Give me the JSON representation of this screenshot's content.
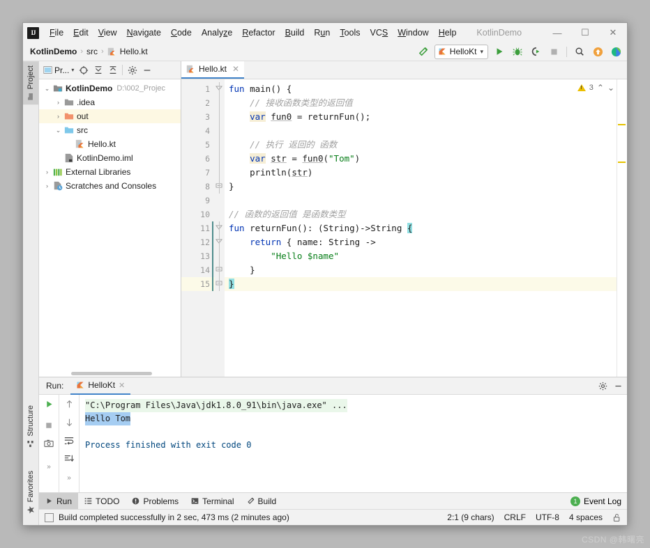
{
  "window": {
    "title": "KotlinDemo",
    "minimize": "—",
    "maximize": "☐",
    "close": "✕"
  },
  "menu": {
    "items": [
      {
        "label": "File",
        "mnemonic": "F"
      },
      {
        "label": "Edit",
        "mnemonic": "E"
      },
      {
        "label": "View",
        "mnemonic": "V"
      },
      {
        "label": "Navigate",
        "mnemonic": "N"
      },
      {
        "label": "Code",
        "mnemonic": "C"
      },
      {
        "label": "Analyze",
        "mnemonic": "z"
      },
      {
        "label": "Refactor",
        "mnemonic": "R"
      },
      {
        "label": "Build",
        "mnemonic": "B"
      },
      {
        "label": "Run",
        "mnemonic": "u"
      },
      {
        "label": "Tools",
        "mnemonic": "T"
      },
      {
        "label": "VCS",
        "mnemonic": "S"
      },
      {
        "label": "Window",
        "mnemonic": "W"
      },
      {
        "label": "Help",
        "mnemonic": "H"
      }
    ]
  },
  "breadcrumb": {
    "project": "KotlinDemo",
    "folder": "src",
    "file": "Hello.kt",
    "separator": "›"
  },
  "toolbar": {
    "run_config": "HelloKt",
    "dropdown_arrow": "▾",
    "icons": [
      "build-hammer-icon",
      "run-icon",
      "debug-icon",
      "run-coverage-icon",
      "stop-icon",
      "search-everywhere-icon",
      "update-project-icon",
      "ide-help-icon"
    ]
  },
  "tool_strip": {
    "left": [
      {
        "label": "Project",
        "active": true
      },
      {
        "label": "Structure",
        "active": false
      },
      {
        "label": "Favorites",
        "active": false
      }
    ]
  },
  "project_panel": {
    "title": "Pr...",
    "toolbar_icons": [
      "select-opened-file-icon",
      "expand-all-icon",
      "collapse-all-icon",
      "settings-gear-icon",
      "hide-icon"
    ],
    "tree": [
      {
        "label": "KotlinDemo",
        "path": "D:\\002_Projec",
        "icon": "module-icon",
        "twist": "⌄",
        "indent": 0,
        "bold": true,
        "highlight": false
      },
      {
        "label": ".idea",
        "path": "",
        "icon": "folder-grey-icon",
        "twist": "›",
        "indent": 1,
        "bold": false,
        "highlight": false
      },
      {
        "label": "out",
        "path": "",
        "icon": "folder-orange-icon",
        "twist": "›",
        "indent": 1,
        "bold": false,
        "highlight": true
      },
      {
        "label": "src",
        "path": "",
        "icon": "folder-blue-icon",
        "twist": "⌄",
        "indent": 1,
        "bold": false,
        "highlight": false
      },
      {
        "label": "Hello.kt",
        "path": "",
        "icon": "kotlin-file-icon",
        "twist": "",
        "indent": 2,
        "bold": false,
        "highlight": false
      },
      {
        "label": "KotlinDemo.iml",
        "path": "",
        "icon": "iml-file-icon",
        "twist": "",
        "indent": 1,
        "bold": false,
        "highlight": false
      },
      {
        "label": "External Libraries",
        "path": "",
        "icon": "libraries-icon",
        "twist": "›",
        "indent": 0,
        "bold": false,
        "highlight": false
      },
      {
        "label": "Scratches and Consoles",
        "path": "",
        "icon": "scratches-icon",
        "twist": "›",
        "indent": 0,
        "bold": false,
        "highlight": false
      }
    ]
  },
  "editor": {
    "tab": {
      "label": "Hello.kt",
      "icon": "kotlin-file-icon",
      "close": "✕"
    },
    "inspection": {
      "count": "3",
      "icon": "warning-triangle-icon",
      "prev": "⌃",
      "next": "⌄"
    },
    "line_count": 15,
    "current_line": 15,
    "lines": [
      {
        "n": "1",
        "html": "<span class=\"kw\">fun</span> <span class=\"fnname\">main</span>() {"
      },
      {
        "n": "2",
        "html": "    <span class=\"cmt\">// 接收函数类型的返回值</span>"
      },
      {
        "n": "3",
        "html": "    <span class=\"kw varhl\">var</span> <span class=\"und\">fun0</span> = <span class=\"fnname\">returnFun</span>();"
      },
      {
        "n": "4",
        "html": ""
      },
      {
        "n": "5",
        "html": "    <span class=\"cmt\">// 执行 返回的 函数</span>"
      },
      {
        "n": "6",
        "html": "    <span class=\"kw varhl\">var</span> <span class=\"und\">str</span> = <span class=\"und\">fun0</span>(<span class=\"str\">\"Tom\"</span>)"
      },
      {
        "n": "7",
        "html": "    <span class=\"fnname\">println</span>(<span class=\"und\">str</span>)"
      },
      {
        "n": "8",
        "html": "}"
      },
      {
        "n": "9",
        "html": ""
      },
      {
        "n": "10",
        "html": "<span class=\"cmt\">// 函数的返回值 是函数类型</span>"
      },
      {
        "n": "11",
        "html": "<span class=\"kw\">fun</span> <span class=\"fnname\">returnFun</span>(): (String)-&gt;String <span class=\"brhl\">{</span>"
      },
      {
        "n": "12",
        "html": "    <span class=\"kw\">return</span> { name: String -&gt;"
      },
      {
        "n": "13",
        "html": "        <span class=\"str\">\"Hello $name\"</span>"
      },
      {
        "n": "14",
        "html": "    }"
      },
      {
        "n": "15",
        "html": "<span class=\"brhl\">}</span>"
      }
    ],
    "plain_text": "fun main() {\n    // 接收函数类型的返回值\n    var fun0 = returnFun();\n\n    // 执行 返回的 函数\n    var str = fun0(\"Tom\")\n    println(str)\n}\n\n// 函数的返回值 是函数类型\nfun returnFun(): (String)->String {\n    return { name: String ->\n        \"Hello $name\"\n    }\n}"
  },
  "run_window": {
    "label": "Run:",
    "tab": "HelloKt",
    "tab_close": "✕",
    "header_icons": [
      "settings-gear-icon",
      "hide-icon"
    ],
    "tools_left": [
      "rerun-icon",
      "stop-icon",
      "screenshot-icon",
      "expand-icon"
    ],
    "tools_right": [
      "up-arrow-icon",
      "down-arrow-icon",
      "soft-wrap-icon",
      "scroll-to-end-icon",
      "expand-icon"
    ],
    "console": {
      "command": "\"C:\\Program Files\\Java\\jdk1.8.0_91\\bin\\java.exe\" ...",
      "output": "Hello Tom",
      "finished": "Process finished with exit code 0"
    }
  },
  "bottom_bar": {
    "items": [
      {
        "label": "Run",
        "icon": "run-icon",
        "active": true
      },
      {
        "label": "TODO",
        "icon": "todo-icon",
        "active": false
      },
      {
        "label": "Problems",
        "icon": "problems-icon",
        "active": false
      },
      {
        "label": "Terminal",
        "icon": "terminal-icon",
        "active": false
      },
      {
        "label": "Build",
        "icon": "build-hammer-icon",
        "active": false
      }
    ],
    "event_log": {
      "label": "Event Log",
      "count": "1"
    }
  },
  "status_bar": {
    "message": "Build completed successfully in 2 sec, 473 ms (2 minutes ago)",
    "caret": "2:1 (9 chars)",
    "line_separator": "CRLF",
    "encoding": "UTF-8",
    "indent": "4 spaces",
    "lock_icon": "unlocked-icon"
  },
  "watermark": "CSDN @韩曙亮",
  "colors": {
    "accent": "#4083c9",
    "keyword": "#0033b3",
    "string": "#067d17",
    "comment": "#a1a1a1",
    "warning": "#ecbf00",
    "run_green": "#3c9e3c",
    "highlight_row": "#fdf8e3"
  }
}
